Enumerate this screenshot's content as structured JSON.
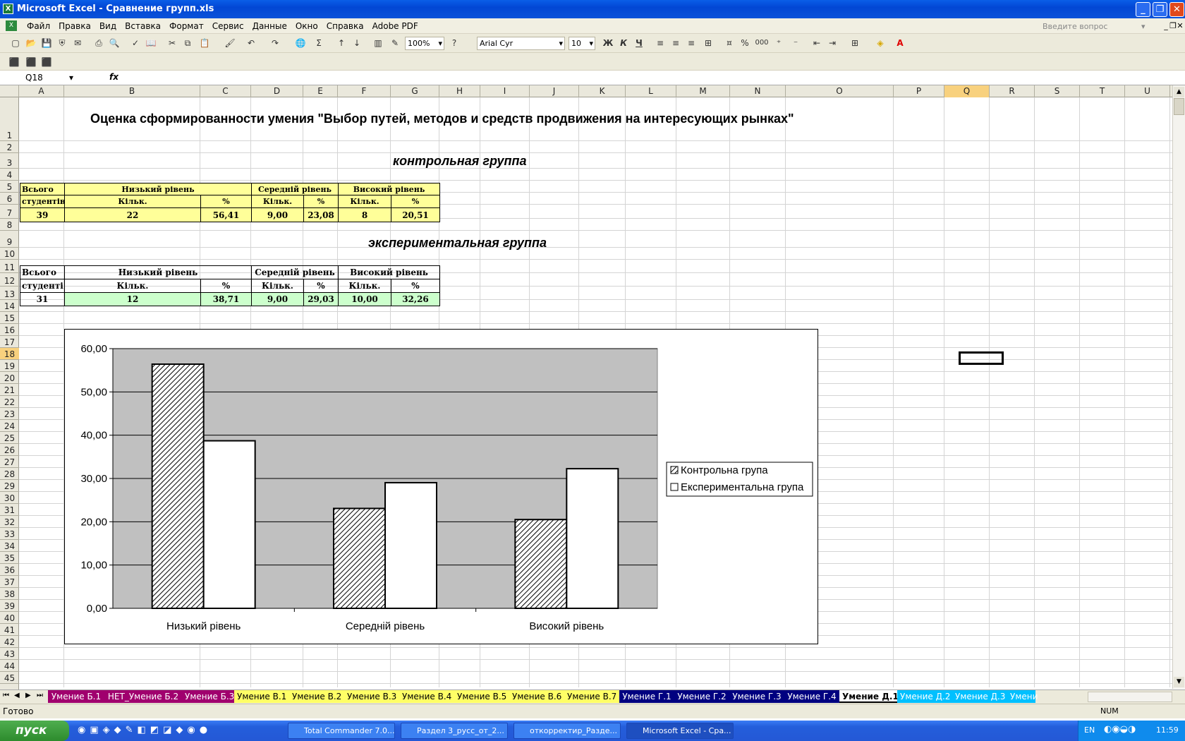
{
  "window": {
    "title": "Microsoft Excel - Сравнение групп.xls"
  },
  "menu": [
    "Файл",
    "Правка",
    "Вид",
    "Вставка",
    "Формат",
    "Сервис",
    "Данные",
    "Окно",
    "Справка",
    "Adobe PDF"
  ],
  "help_placeholder": "Введите вопрос",
  "toolbar": {
    "zoom": "100%",
    "font": "Arial Cyr",
    "size": "10",
    "bold": "Ж",
    "italic": "К",
    "underline": "Ч",
    "percent": "%",
    "thousands": "000"
  },
  "namebox": "Q18",
  "fx": "fx",
  "columns": [
    "A",
    "B",
    "C",
    "D",
    "E",
    "F",
    "G",
    "H",
    "I",
    "J",
    "K",
    "L",
    "M",
    "N",
    "O",
    "P",
    "Q",
    "R",
    "S",
    "T",
    "U"
  ],
  "rows": [
    "1",
    "2",
    "3",
    "4",
    "5",
    "6",
    "7",
    "8",
    "9",
    "10",
    "11",
    "12",
    "13",
    "14",
    "15",
    "16",
    "17",
    "18",
    "19",
    "20",
    "21",
    "22",
    "23",
    "24",
    "25",
    "26",
    "27",
    "28",
    "29",
    "30",
    "31",
    "32",
    "33",
    "34",
    "35",
    "36",
    "37",
    "38",
    "39",
    "40",
    "41",
    "42",
    "43",
    "44",
    "45"
  ],
  "sheet": {
    "title": "Оценка сформированности умения \"Выбор путей, методов и средств продвижения на интересующих рынках\"",
    "control_title": "контрольная группа",
    "control": {
      "h_total1": "Всього",
      "h_total2": "студентів:",
      "h_low": "Низький рівень",
      "h_mid": "Середній рівень",
      "h_high": "Високий рівень",
      "h_count": "Кільк.",
      "h_pct": "%",
      "total": "39",
      "low_n": "22",
      "low_p": "56,41",
      "mid_n": "9,00",
      "mid_p": "23,08",
      "high_n": "8",
      "high_p": "20,51"
    },
    "exp_title": "экспериментальная группа",
    "exp": {
      "h_total1": "Всього",
      "h_total2": "студенті",
      "h_low": "Низький рівень",
      "h_mid": "Середній рівень",
      "h_high": "Високий рівень",
      "h_count": "Кільк.",
      "h_pct": "%",
      "total": "31",
      "low_n": "12",
      "low_p": "38,71",
      "mid_n": "9,00",
      "mid_p": "29,03",
      "high_n": "10,00",
      "high_p": "32,26"
    }
  },
  "chart_data": {
    "type": "bar",
    "categories": [
      "Низький рівень",
      "Середній рівень",
      "Високий рівень"
    ],
    "series": [
      {
        "name": "Контрольна група",
        "values": [
          56.41,
          23.08,
          20.51
        ],
        "fill": "hatched"
      },
      {
        "name": "Експериментальна група",
        "values": [
          38.71,
          29.03,
          32.26
        ],
        "fill": "#ffffff"
      }
    ],
    "ylim": [
      0,
      60
    ],
    "yticks": [
      "0,00",
      "10,00",
      "20,00",
      "30,00",
      "40,00",
      "50,00",
      "60,00"
    ],
    "plot_bg": "#c0c0c0",
    "grid": true,
    "legend": "right"
  },
  "tabs": [
    "Умение Б.1",
    "НЕТ_Умение Б.2",
    "Умение Б.3",
    "Умение В.1",
    "Умение В.2",
    "Умение В.3",
    "Умение В.4",
    "Умение В.5",
    "Умение В.6",
    "Умение В.7",
    "Умение Г.1",
    "Умение Г.2",
    "Умение Г.3",
    "Умение Г.4",
    "Умение Д.1",
    "Умение Д.2",
    "Умение Д.3",
    "Умени"
  ],
  "status": {
    "left": "Готово",
    "num": "NUM"
  },
  "taskbar": {
    "start": "пуск",
    "tasks": [
      "Total Commander 7.0...",
      "Раздел 3_русс_от_2...",
      "откорректир_Разде...",
      "Microsoft Excel - Сра..."
    ],
    "lang": "EN",
    "clock": "11:59"
  }
}
